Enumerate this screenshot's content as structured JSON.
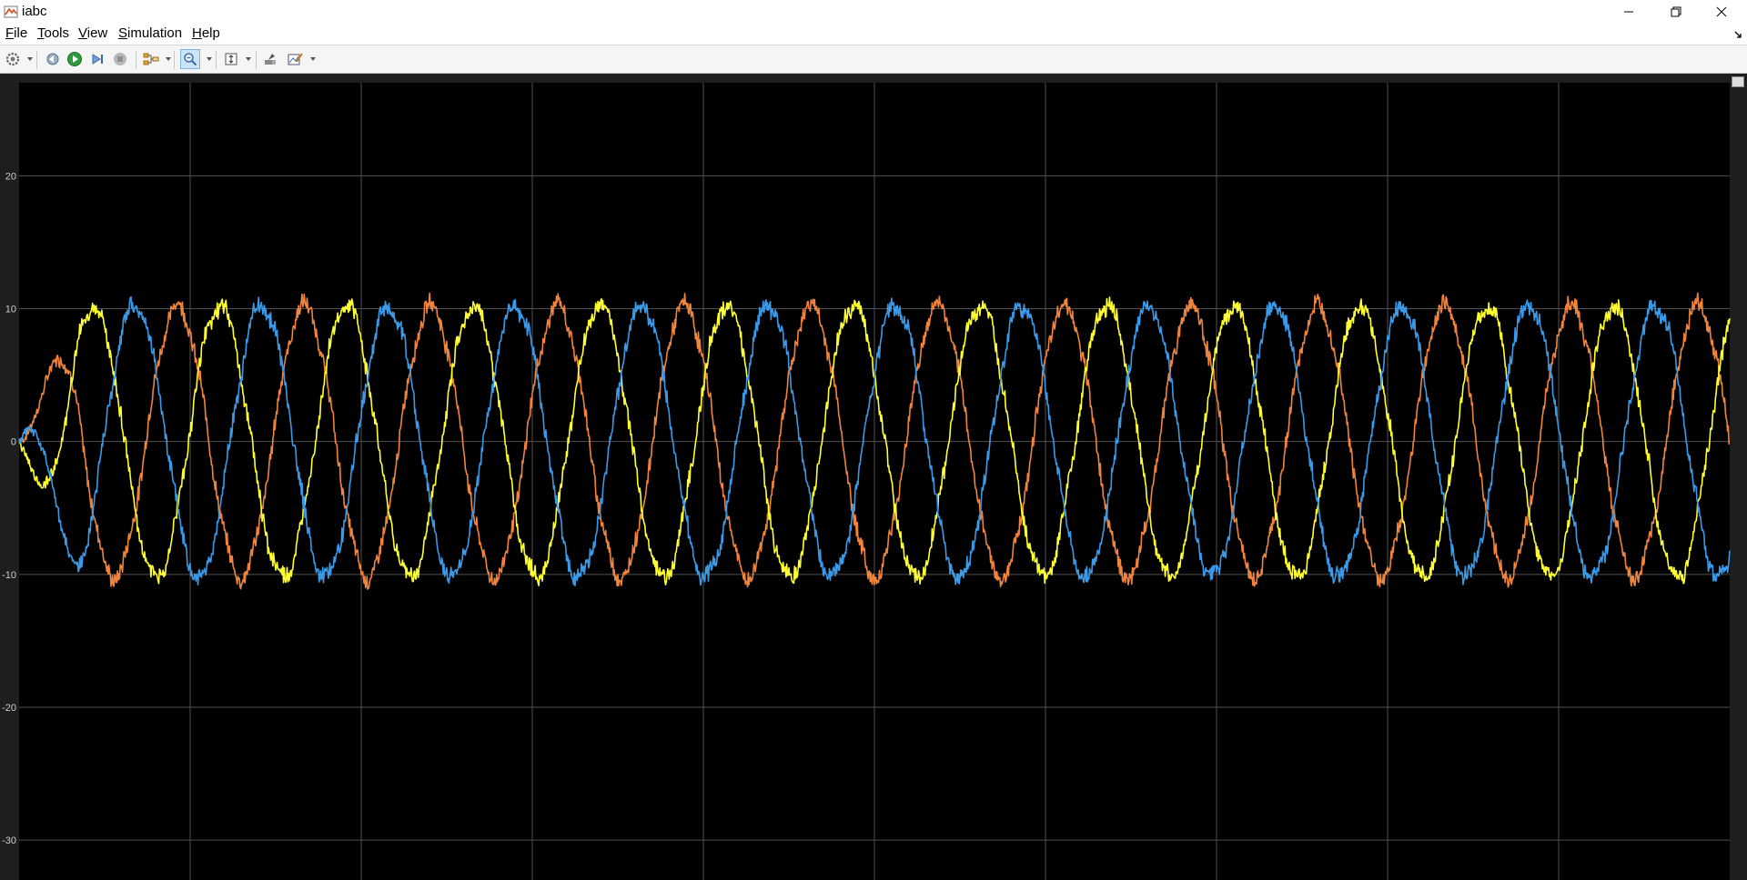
{
  "window": {
    "title": "iabc",
    "icon": "matlab-scope-icon",
    "controls": [
      "minimize-icon",
      "restore-icon",
      "close-icon"
    ]
  },
  "menu": [
    {
      "accel": "F",
      "rest": "ile"
    },
    {
      "accel": "T",
      "rest": "ools"
    },
    {
      "accel": "V",
      "rest": "iew"
    },
    {
      "accel": "S",
      "rest": "imulation"
    },
    {
      "accel": "H",
      "rest": "elp"
    }
  ],
  "toolbar": {
    "icons": [
      "settings-icon",
      "step-back-icon",
      "run-icon",
      "step-forward-icon",
      "stop-icon",
      "highlight-block-icon",
      "zoom-icon",
      "scale-axes-icon",
      "restore-view-icon",
      "measurements-icon"
    ]
  },
  "colors": {
    "phase_a": "#f0843c",
    "phase_b": "#ffff33",
    "phase_c": "#3a9ae8",
    "plot_bg": "#000000",
    "grid": "#505050",
    "tick_text": "#cccccc"
  },
  "chart_data": {
    "type": "line",
    "title": "",
    "xlabel": "",
    "ylabel": "",
    "yticks": [
      "20",
      "10",
      "0",
      "-10",
      "-20",
      "-30"
    ],
    "ylim": [
      -33,
      27
    ],
    "x_gridlines": 10,
    "grid": true,
    "legend": "none",
    "series": [
      {
        "color": "#f0843c",
        "amplitude": 10.2,
        "phase_deg": 0,
        "cycles": 13.5,
        "startup_peak": 9.5
      },
      {
        "color": "#ffff33",
        "amplitude": 10.2,
        "phase_deg": -120,
        "cycles": 13.5,
        "startup_peak": 11.2
      },
      {
        "color": "#3a9ae8",
        "amplitude": 10.2,
        "phase_deg": 120,
        "cycles": 13.5,
        "startup_peak": -11.0
      }
    ]
  }
}
